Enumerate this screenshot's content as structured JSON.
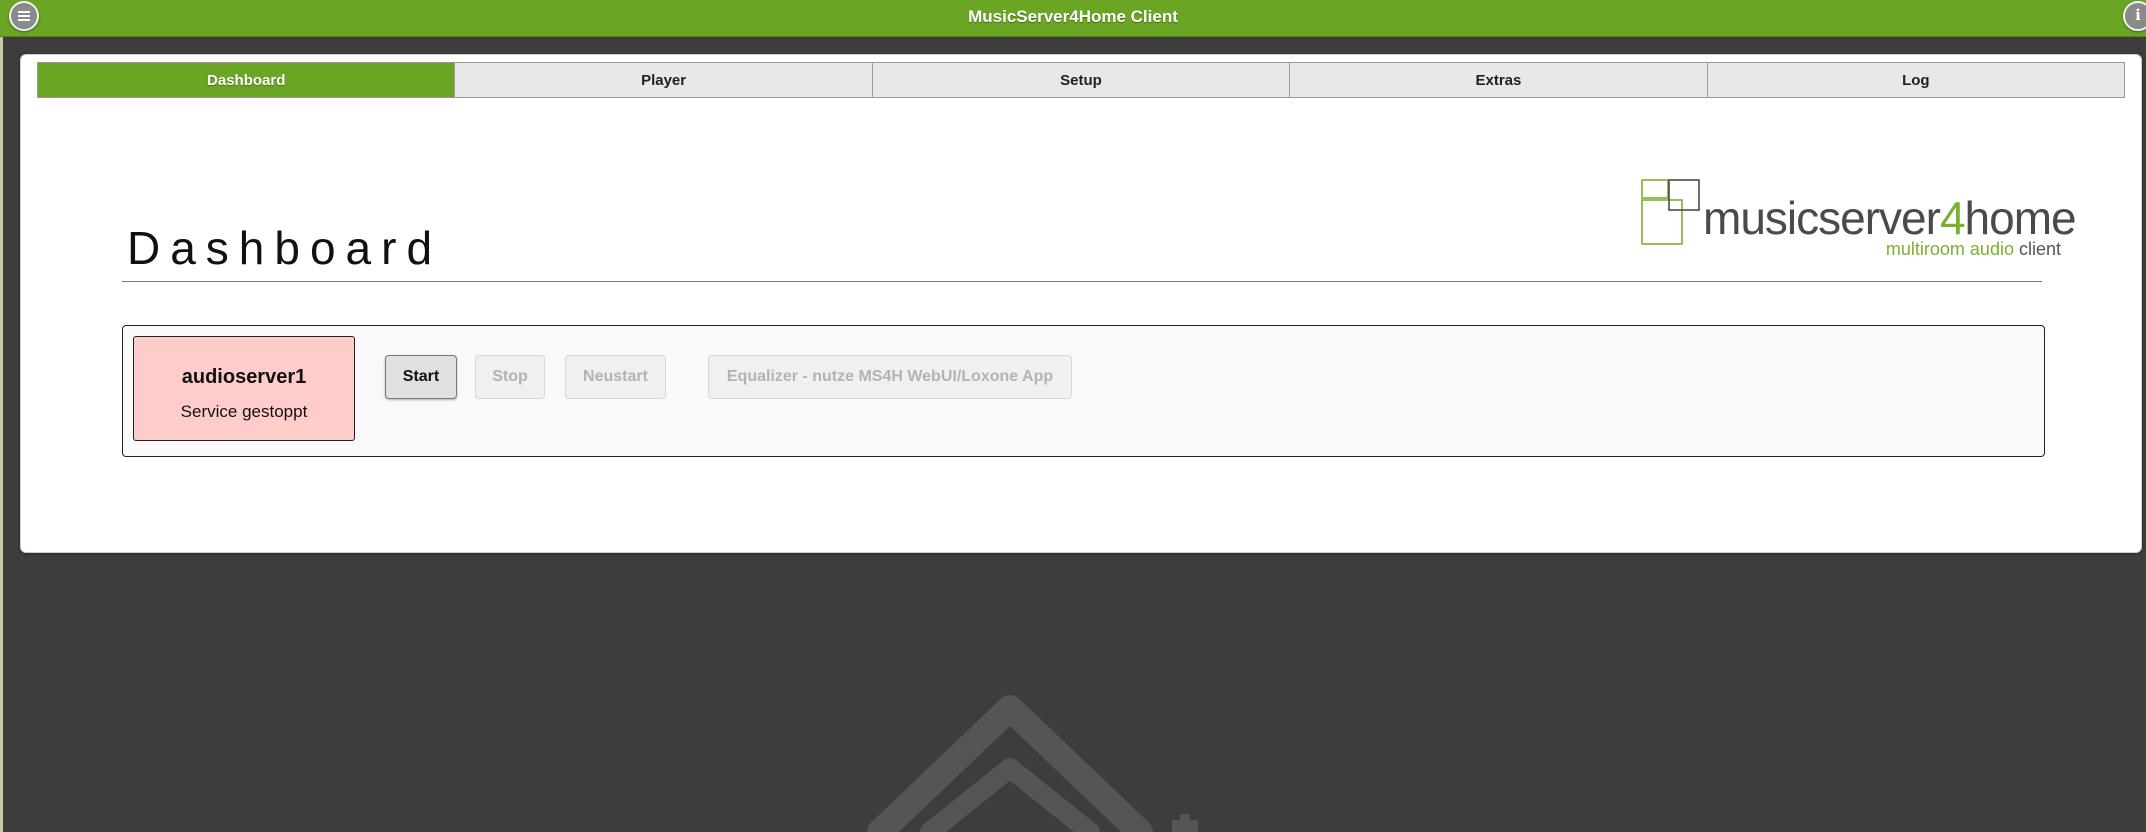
{
  "app": {
    "title": "MusicServer4Home Client"
  },
  "header": {
    "menu_icon": "menu-icon",
    "info_icon": "info-icon",
    "info_glyph": "i"
  },
  "tabs": [
    {
      "label": "Dashboard",
      "active": true
    },
    {
      "label": "Player",
      "active": false
    },
    {
      "label": "Setup",
      "active": false
    },
    {
      "label": "Extras",
      "active": false
    },
    {
      "label": "Log",
      "active": false
    }
  ],
  "page": {
    "title": "Dashboard"
  },
  "logo": {
    "name_main": "musicserver",
    "name_digit": "4",
    "name_end": "home",
    "sub_green": "multiroom audio ",
    "sub_dark": "client"
  },
  "service": {
    "name": "audioserver1",
    "status": "Service gestoppt",
    "status_color": "#ffcccc",
    "buttons": {
      "start": "Start",
      "stop": "Stop",
      "restart": "Neustart",
      "equalizer": "Equalizer - nutze MS4H WebUI/Loxone App"
    }
  },
  "colors": {
    "accent": "#6aa524",
    "background": "#3d3d3d"
  }
}
